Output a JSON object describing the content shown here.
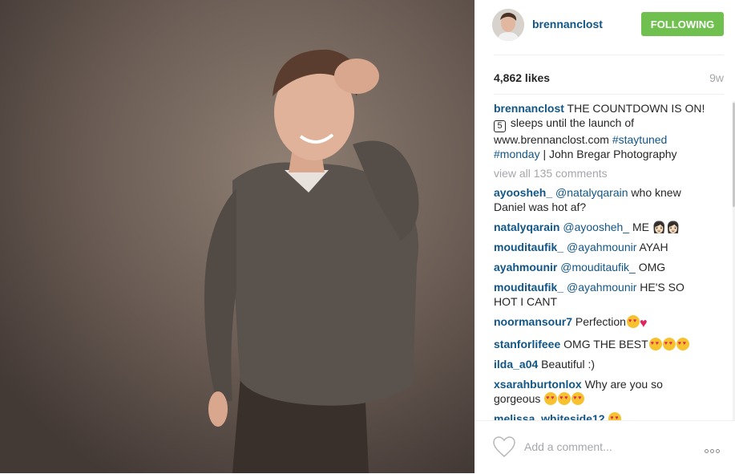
{
  "post": {
    "username": "brennanclost",
    "follow_label": "FOLLOWING",
    "likes": "4,862 likes",
    "age": "9w",
    "caption": {
      "user": "brennanclost",
      "text1": " THE COUNTDOWN IS ON! ",
      "badge": "5",
      "text2": " sleeps until the launch of www.brennanclost.com ",
      "tag1": "#staytuned",
      "tag2": "#monday",
      "text3": " | John Bregar Photography"
    },
    "view_all": "view all 135 comments",
    "comments": [
      {
        "user": "ayoosheh_",
        "mention": "@natalyqarain",
        "text": " who knew Daniel was hot af?"
      },
      {
        "user": "natalyqarain",
        "mention": "@ayoosheh_",
        "text": " ME 👩🏻👩🏻"
      },
      {
        "user": "mouditaufik_",
        "mention": "@ayahmounir",
        "text": " AYAH"
      },
      {
        "user": "ayahmounir",
        "mention": "@mouditaufik_",
        "text": " OMG"
      },
      {
        "user": "mouditaufik_",
        "mention": "@ayahmounir",
        "text": " HE'S SO HOT I CANT"
      },
      {
        "user": "noormansour7",
        "mention": "",
        "text": " Perfection"
      },
      {
        "user": "stanforlifeee",
        "mention": "",
        "text": " OMG THE BEST"
      },
      {
        "user": "ilda_a04",
        "mention": "",
        "text": " Beautiful :)"
      },
      {
        "user": "xsarahburtonlox",
        "mention": "",
        "text": " Why are you so gorgeous "
      },
      {
        "user": "melissa_whiteside12",
        "mention": "",
        "text": " "
      }
    ],
    "comment_placeholder": "Add a comment...",
    "icons": {
      "like": "heart-outline-icon",
      "more": "more-options-icon"
    }
  }
}
